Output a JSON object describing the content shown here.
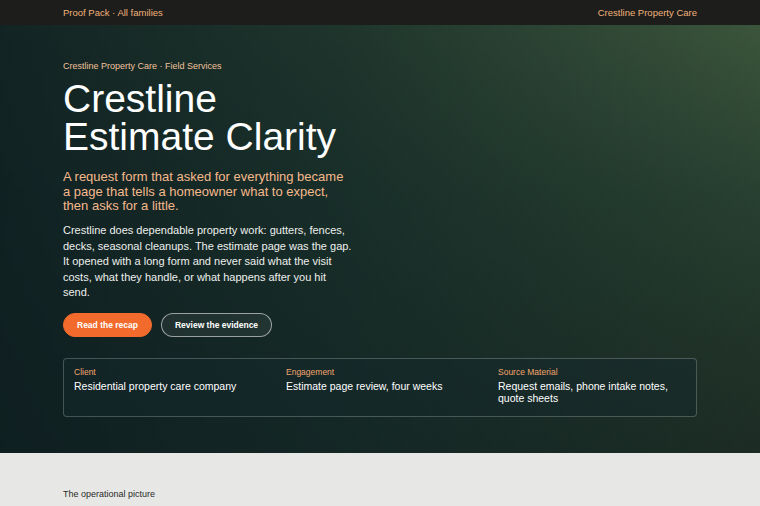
{
  "topbar": {
    "left": "Proof Pack · All families",
    "right": "Crestline Property Care"
  },
  "hero": {
    "eyebrow": "Crestline Property Care · Field Services",
    "title": "Crestline Estimate Clarity",
    "subtitle": "A request form that asked for everything became a page that tells a homeowner what to expect, then asks for a little.",
    "body": "Crestline does dependable property work: gutters, fences, decks, seasonal cleanups. The estimate page was the gap. It opened with a long form and never said what the visit costs, what they handle, or what happens after you hit send.",
    "buttons": [
      {
        "label": "Read the recap",
        "kind": "primary"
      },
      {
        "label": "Review the evidence",
        "kind": "outline"
      }
    ],
    "facts": [
      {
        "label": "Client",
        "value": "Residential property care company"
      },
      {
        "label": "Engagement",
        "value": "Estimate page review, four weeks"
      },
      {
        "label": "Source Material",
        "value": "Request emails, phone intake notes, quote sheets"
      }
    ]
  },
  "section": {
    "heading": "The operational picture"
  }
}
